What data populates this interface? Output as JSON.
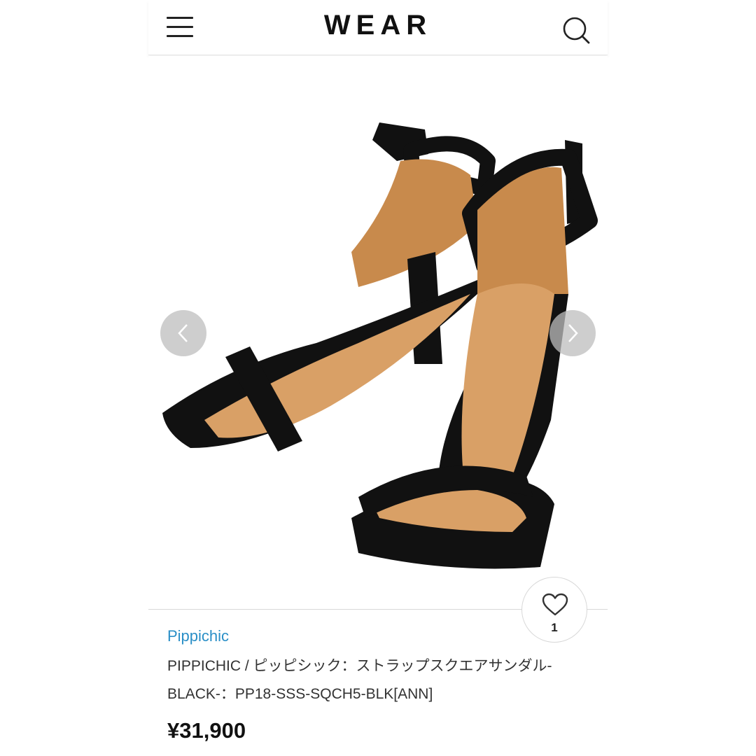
{
  "header": {
    "logo": "WEAR",
    "menu_icon": "hamburger-menu-icon",
    "search_icon": "search-icon"
  },
  "gallery": {
    "image_alt": "black suede square-toe ankle strap sandals",
    "prev_icon": "chevron-left-icon",
    "next_icon": "chevron-right-icon"
  },
  "favorite": {
    "icon": "heart-icon",
    "count": "1"
  },
  "product": {
    "brand": "Pippichic",
    "name": "PIPPICHIC / ピッピシック：ストラップスクエアサンダル-BLACK-：PP18-SSS-SQCH5-BLK[ANN]",
    "price": "¥31,900"
  },
  "colors": {
    "brand_link": "#2a8fc7",
    "sandal": "#111111",
    "insole": "#d9a066"
  }
}
